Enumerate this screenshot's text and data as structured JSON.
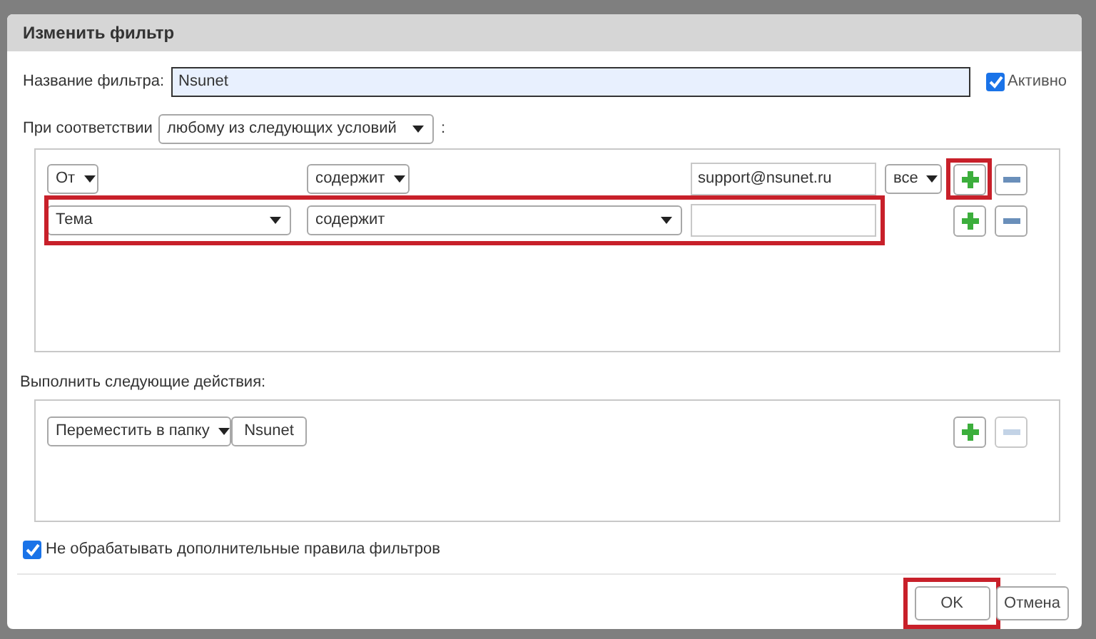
{
  "dialog": {
    "title": "Изменить фильтр"
  },
  "name_field": {
    "label": "Название фильтра:",
    "value": "Nsunet"
  },
  "active": {
    "label": "Активно",
    "checked": true
  },
  "match": {
    "label": "При соответствии",
    "value": "любому из следующих условий",
    "suffix": ":"
  },
  "conditions": [
    {
      "field": "От",
      "operator": "содержит",
      "value": "support@nsunet.ru",
      "scope": "все",
      "highlighted": false,
      "add_highlighted": true,
      "remove_disabled": false
    },
    {
      "field": "Тема",
      "operator": "содержит",
      "highlighted": true,
      "add_highlighted": false,
      "remove_disabled": false
    }
  ],
  "actions_label": "Выполнить следующие действия:",
  "actions": [
    {
      "action": "Переместить в папку",
      "target": "Nsunet",
      "add_highlighted": false,
      "remove_disabled": true
    }
  ],
  "stop_rules": {
    "label": "Не обрабатывать дополнительные правила фильтров",
    "checked": true
  },
  "buttons": [
    {
      "label": "OK",
      "highlighted": true
    },
    {
      "label": "Отмена",
      "highlighted": false
    }
  ]
}
